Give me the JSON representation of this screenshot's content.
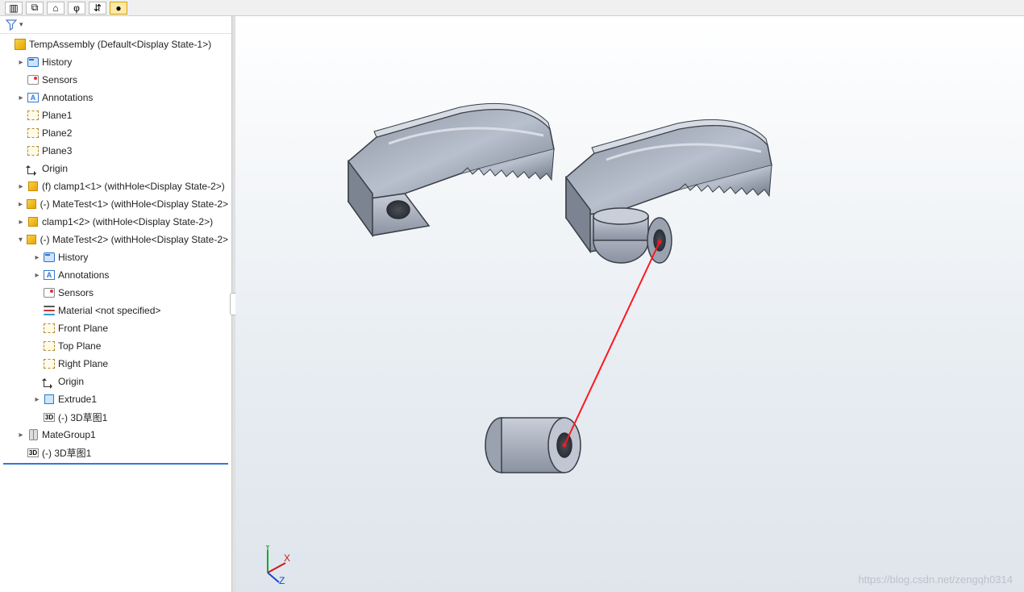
{
  "toolbar": {
    "icons": [
      "panel-icon",
      "layout-icon",
      "home-icon",
      "info-icon",
      "swap-icon",
      "globe-icon"
    ]
  },
  "filter": {
    "tooltip": "Filter"
  },
  "tree": {
    "root": {
      "label": "TempAssembly  (Default<Display State-1>)"
    },
    "items": [
      {
        "indent": 1,
        "exp": "▸",
        "icon": "folder-history",
        "label": "History"
      },
      {
        "indent": 1,
        "exp": "",
        "icon": "sensor",
        "label": "Sensors"
      },
      {
        "indent": 1,
        "exp": "▸",
        "icon": "annotations",
        "label": "Annotations"
      },
      {
        "indent": 1,
        "exp": "",
        "icon": "plane",
        "label": "Plane1"
      },
      {
        "indent": 1,
        "exp": "",
        "icon": "plane",
        "label": "Plane2"
      },
      {
        "indent": 1,
        "exp": "",
        "icon": "plane",
        "label": "Plane3"
      },
      {
        "indent": 1,
        "exp": "",
        "icon": "origin",
        "label": "Origin"
      },
      {
        "indent": 1,
        "exp": "▸",
        "icon": "part",
        "label": "(f) clamp1<1> (withHole<Display State-2>)"
      },
      {
        "indent": 1,
        "exp": "▸",
        "icon": "part",
        "label": "(-) MateTest<1> (withHole<Display State-2>"
      },
      {
        "indent": 1,
        "exp": "▸",
        "icon": "part",
        "label": "clamp1<2> (withHole<Display State-2>)"
      },
      {
        "indent": 1,
        "exp": "▾",
        "icon": "part",
        "label": "(-) MateTest<2> (withHole<Display State-2>"
      },
      {
        "indent": 2,
        "exp": "▸",
        "icon": "folder-history",
        "label": "History"
      },
      {
        "indent": 2,
        "exp": "▸",
        "icon": "annotations",
        "label": "Annotations"
      },
      {
        "indent": 2,
        "exp": "",
        "icon": "sensor",
        "label": "Sensors"
      },
      {
        "indent": 2,
        "exp": "",
        "icon": "material",
        "label": "Material <not specified>"
      },
      {
        "indent": 2,
        "exp": "",
        "icon": "plane",
        "label": "Front Plane"
      },
      {
        "indent": 2,
        "exp": "",
        "icon": "plane",
        "label": "Top Plane"
      },
      {
        "indent": 2,
        "exp": "",
        "icon": "plane",
        "label": "Right Plane"
      },
      {
        "indent": 2,
        "exp": "",
        "icon": "origin",
        "label": "Origin"
      },
      {
        "indent": 2,
        "exp": "▸",
        "icon": "extrude",
        "label": "Extrude1"
      },
      {
        "indent": 2,
        "exp": "",
        "icon": "sketch3d",
        "label": "(-) 3D草图1"
      },
      {
        "indent": 1,
        "exp": "▸",
        "icon": "mates",
        "label": "MateGroup1"
      },
      {
        "indent": 1,
        "exp": "",
        "icon": "sketch3d",
        "label": "(-) 3D草图1"
      }
    ]
  },
  "viewport": {
    "triad_labels": {
      "x": "X",
      "y": "Y",
      "z": "Z"
    },
    "watermark": "https://blog.csdn.net/zengqh0314"
  }
}
